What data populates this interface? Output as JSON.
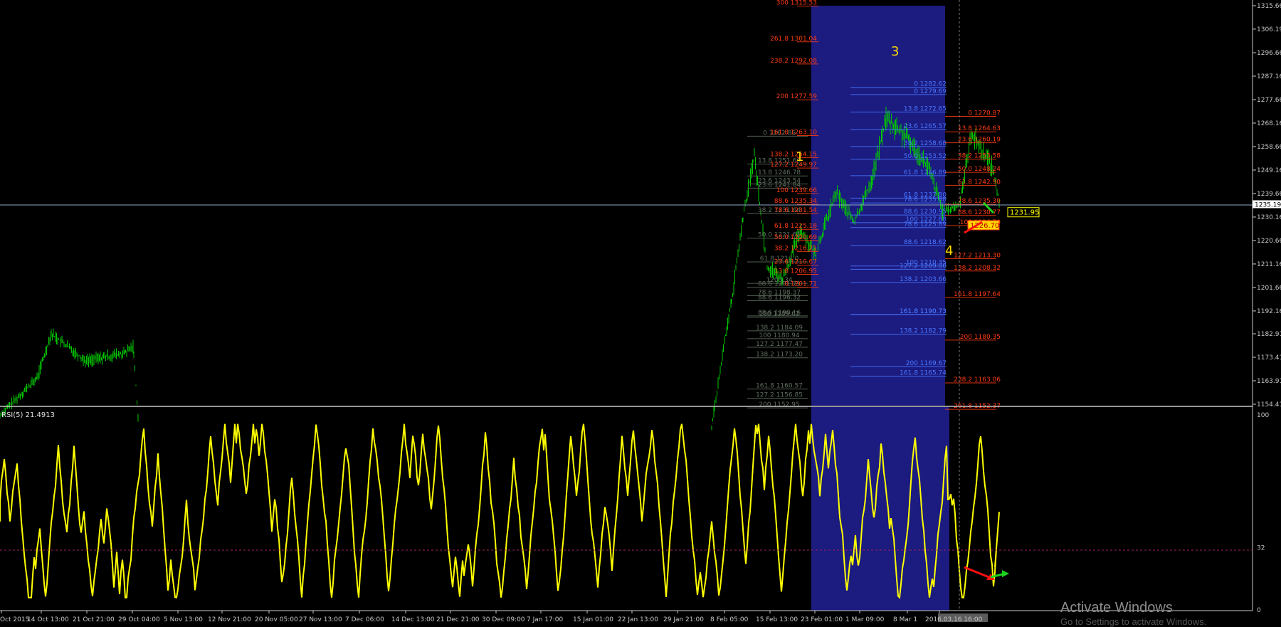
{
  "colors": {
    "price": "#00c800",
    "rsi": "#ffff00",
    "highlight": "#1b1b80",
    "fib_gray": "#5f6f5f",
    "fib_blue": "#4a78ff",
    "fib_red": "#ff3c14",
    "axis": "#c8c8c8",
    "wave": "#ffd700"
  },
  "watermark": {
    "title": "Activate Windows",
    "sub": "Go to Settings to activate Windows."
  },
  "rsi_title": "RSI(5) 21.4913",
  "chart_data": [
    {
      "type": "line",
      "name": "price-panel",
      "y_ticks": [
        "1315.66",
        "1306.19",
        "1296.66",
        "1287.16",
        "1277.66",
        "1268.16",
        "1258.66",
        "1249.16",
        "1239.66",
        "1230.16",
        "1220.66",
        "1211.16",
        "1201.66",
        "1192.16",
        "1182.91",
        "1173.41",
        "1163.91",
        "1154.41"
      ],
      "ylim": [
        1154.41,
        1315.66
      ],
      "current_price": "1235.19",
      "bid_label": "1231.95",
      "ask_label": "1226.70",
      "wave_labels": [
        "1",
        "3",
        "4"
      ],
      "fib_gray": [
        "0 1262.86",
        "13.8 1251.60",
        "23.6 1243.54",
        "38.2 1231.64",
        "50.0 1221.61",
        "61.8 1212.0",
        "78.6 1198.37",
        "88.6 1190.16",
        "100 1180.94",
        "127.2 1177.47",
        "138.2 1173.20",
        "161.8 1160.57",
        "127.2 1156.85",
        "200 1152.95",
        "13.8 1246.78",
        "23.6 1241.84",
        "88.6 1196.32",
        "100 1189.62",
        "138.2 1184.09",
        "88.6 1201.71",
        "1203.34"
      ],
      "fib_red_left": [
        "300 1315.53",
        "261.8 1301.04",
        "238.2 1292.08",
        "200 1277.59",
        "161.8 1263.10",
        "138.2 1254.15",
        "127.2 1249.97",
        "100 1239.66",
        "88.6 1235.34",
        "78.6 1231.54",
        "61.8 1225.18",
        "50.0 1220.69",
        "38.2 1216.21",
        "23.6 1210.67",
        "13.8 1206.95",
        "0 1201.71"
      ],
      "fib_blue": [
        "0 1282.62",
        "0 1279.69",
        "13.8 1272.65",
        "23.6 1265.57",
        "38.2 1258.68",
        "50.0 1253.52",
        "61.8 1246.89",
        "61.8 1237.80",
        "78.6 1235.88",
        "88.6 1230.95",
        "100 1227.88",
        "78.6 1225.89",
        "88.6 1218.62",
        "127.2 1209.00",
        "100 1210.35",
        "138.2 1203.66",
        "161.8 1190.73",
        "161.8 1190.73",
        "138.2 1182.79",
        "200 1169.67",
        "161.8 1165.74"
      ],
      "fib_red_right": [
        "0 1270.87",
        "13.8 1264.63",
        "23.6 1260.19",
        "38.2 1253.58",
        "50.0 1248.24",
        "61.8 1242.90",
        "78.6 1235.30",
        "88.6 1230.77",
        "100 1226.70",
        "127.2 1213.30",
        "138.2 1208.32",
        "161.8 1197.64",
        "200 1180.35",
        "238.2 1163.06",
        "261.8 1152.37"
      ],
      "x_ticks": [
        "Oct 2015",
        "14 Oct 13:00",
        "21 Oct 21:00",
        "29 Oct 04:00",
        "5 Nov 13:00",
        "12 Nov 21:00",
        "20 Nov 05:00",
        "27 Nov 13:00",
        "7 Dec 06:00",
        "14 Dec 13:00",
        "21 Dec 21:00",
        "30 Dec 09:00",
        "7 Jan 17:00",
        "15 Jan 01:00",
        "22 Jan 13:00",
        "29 Jan 21:00",
        "8 Feb 05:00",
        "15 Feb 13:00",
        "23 Feb 01:00",
        "1 Mar 09:00",
        "8 Mar 1",
        "2016.03.16 16:00"
      ]
    },
    {
      "type": "line",
      "name": "RSI(5)",
      "ylim": [
        0,
        100
      ],
      "y_ticks": [
        "100",
        "32",
        "0"
      ],
      "level": 32,
      "current": 21.4913
    }
  ]
}
